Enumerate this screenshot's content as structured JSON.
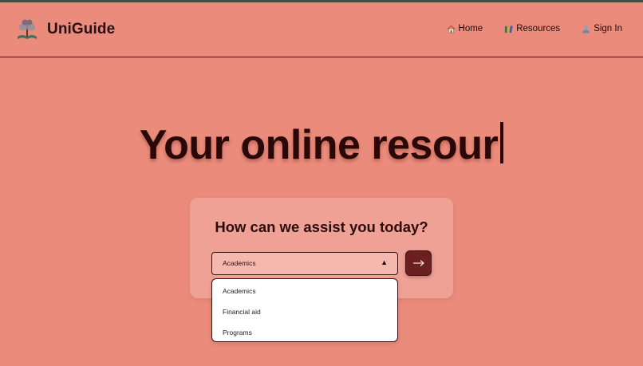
{
  "header": {
    "brand": "UniGuide",
    "nav": [
      {
        "label": "Home",
        "icon": "house-icon"
      },
      {
        "label": "Resources",
        "icon": "books-icon"
      },
      {
        "label": "Sign In",
        "icon": "user-icon"
      }
    ]
  },
  "hero": {
    "typed_text": "Your online resour"
  },
  "assist": {
    "title": "How can we assist you today?",
    "selected": "Academics",
    "arrow": "▲",
    "submit_icon": "arrow-right-icon",
    "options": [
      "Academics",
      "Financial aid",
      "Programs"
    ]
  },
  "colors": {
    "background": "#eb8b7b",
    "card": "#f0a196",
    "select": "#f4b8af",
    "accent": "#6b1f1f",
    "text_dark": "#2b0808"
  }
}
